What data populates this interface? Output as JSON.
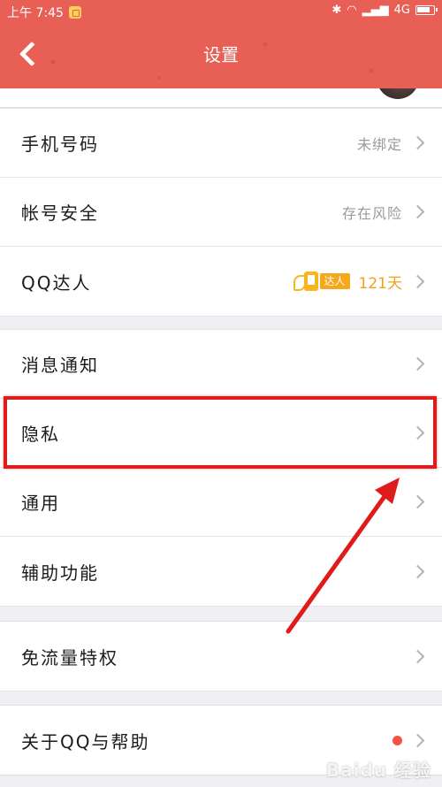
{
  "status_bar": {
    "time": "上午 7:45",
    "network": "4G"
  },
  "nav": {
    "title": "设置"
  },
  "groups": [
    {
      "items": [
        {
          "label": "手机号码",
          "value": "未绑定"
        },
        {
          "label": "帐号安全",
          "value": "存在风险"
        },
        {
          "label": "QQ达人",
          "badge": "达人",
          "value": "121天"
        }
      ]
    },
    {
      "items": [
        {
          "label": "消息通知"
        },
        {
          "label": "隐私"
        },
        {
          "label": "通用"
        },
        {
          "label": "辅助功能"
        }
      ]
    },
    {
      "items": [
        {
          "label": "免流量特权"
        }
      ]
    },
    {
      "items": [
        {
          "label": "关于QQ与帮助"
        }
      ]
    }
  ],
  "annotation": {
    "highlighted_item": "隐私",
    "color": "#e01b1b"
  },
  "colors": {
    "header": "#e85f55",
    "accent": "#f5a81c",
    "notification_dot": "#f25343"
  },
  "watermark": "Baidu 经验"
}
